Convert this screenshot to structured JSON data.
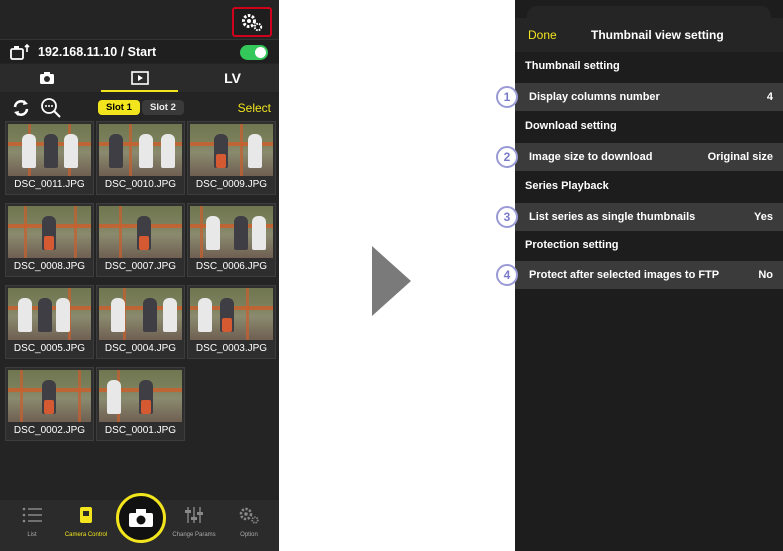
{
  "left_screen": {
    "connection": {
      "address": "192.168.11.10 / Start",
      "toggle_on": true
    },
    "mode_tabs": [
      {
        "icon": "camera-icon",
        "label": ""
      },
      {
        "icon": "playback-icon",
        "label": "",
        "active": true
      },
      {
        "icon": "",
        "label": "LV"
      }
    ],
    "toolbar": {
      "slot1": "Slot 1",
      "slot2": "Slot 2",
      "select": "Select"
    },
    "thumbnails": [
      {
        "label": "DSC_0011.JPG"
      },
      {
        "label": "DSC_0010.JPG"
      },
      {
        "label": "DSC_0009.JPG"
      },
      {
        "label": "DSC_0008.JPG"
      },
      {
        "label": "DSC_0007.JPG"
      },
      {
        "label": "DSC_0006.JPG"
      },
      {
        "label": "DSC_0005.JPG"
      },
      {
        "label": "DSC_0004.JPG"
      },
      {
        "label": "DSC_0003.JPG"
      },
      {
        "label": "DSC_0002.JPG"
      },
      {
        "label": "DSC_0001.JPG"
      }
    ],
    "bottom_bar": [
      {
        "icon": "list-icon",
        "label": "List"
      },
      {
        "icon": "camera-control-icon",
        "label": "Camera Control",
        "active": true
      },
      {
        "icon": "sliders-icon",
        "label": "Change Params"
      },
      {
        "icon": "gear-icon",
        "label": "Option"
      }
    ],
    "colors": {
      "accent": "#f2e51e",
      "highlight_box": "#d0021b",
      "toggle": "#34c759"
    }
  },
  "right_screen": {
    "header": {
      "done": "Done",
      "title": "Thumbnail view setting"
    },
    "sections": [
      {
        "title": "Thumbnail setting",
        "callout": "1",
        "label": "Display columns number",
        "value": "4"
      },
      {
        "title": "Download setting",
        "callout": "2",
        "label": "Image size to download",
        "value": "Original size"
      },
      {
        "title": "Series Playback",
        "callout": "3",
        "label": "List series as single thumbnails",
        "value": "Yes"
      },
      {
        "title": "Protection setting",
        "callout": "4",
        "label": "Protect after selected images to FTP",
        "value": "No"
      }
    ]
  }
}
